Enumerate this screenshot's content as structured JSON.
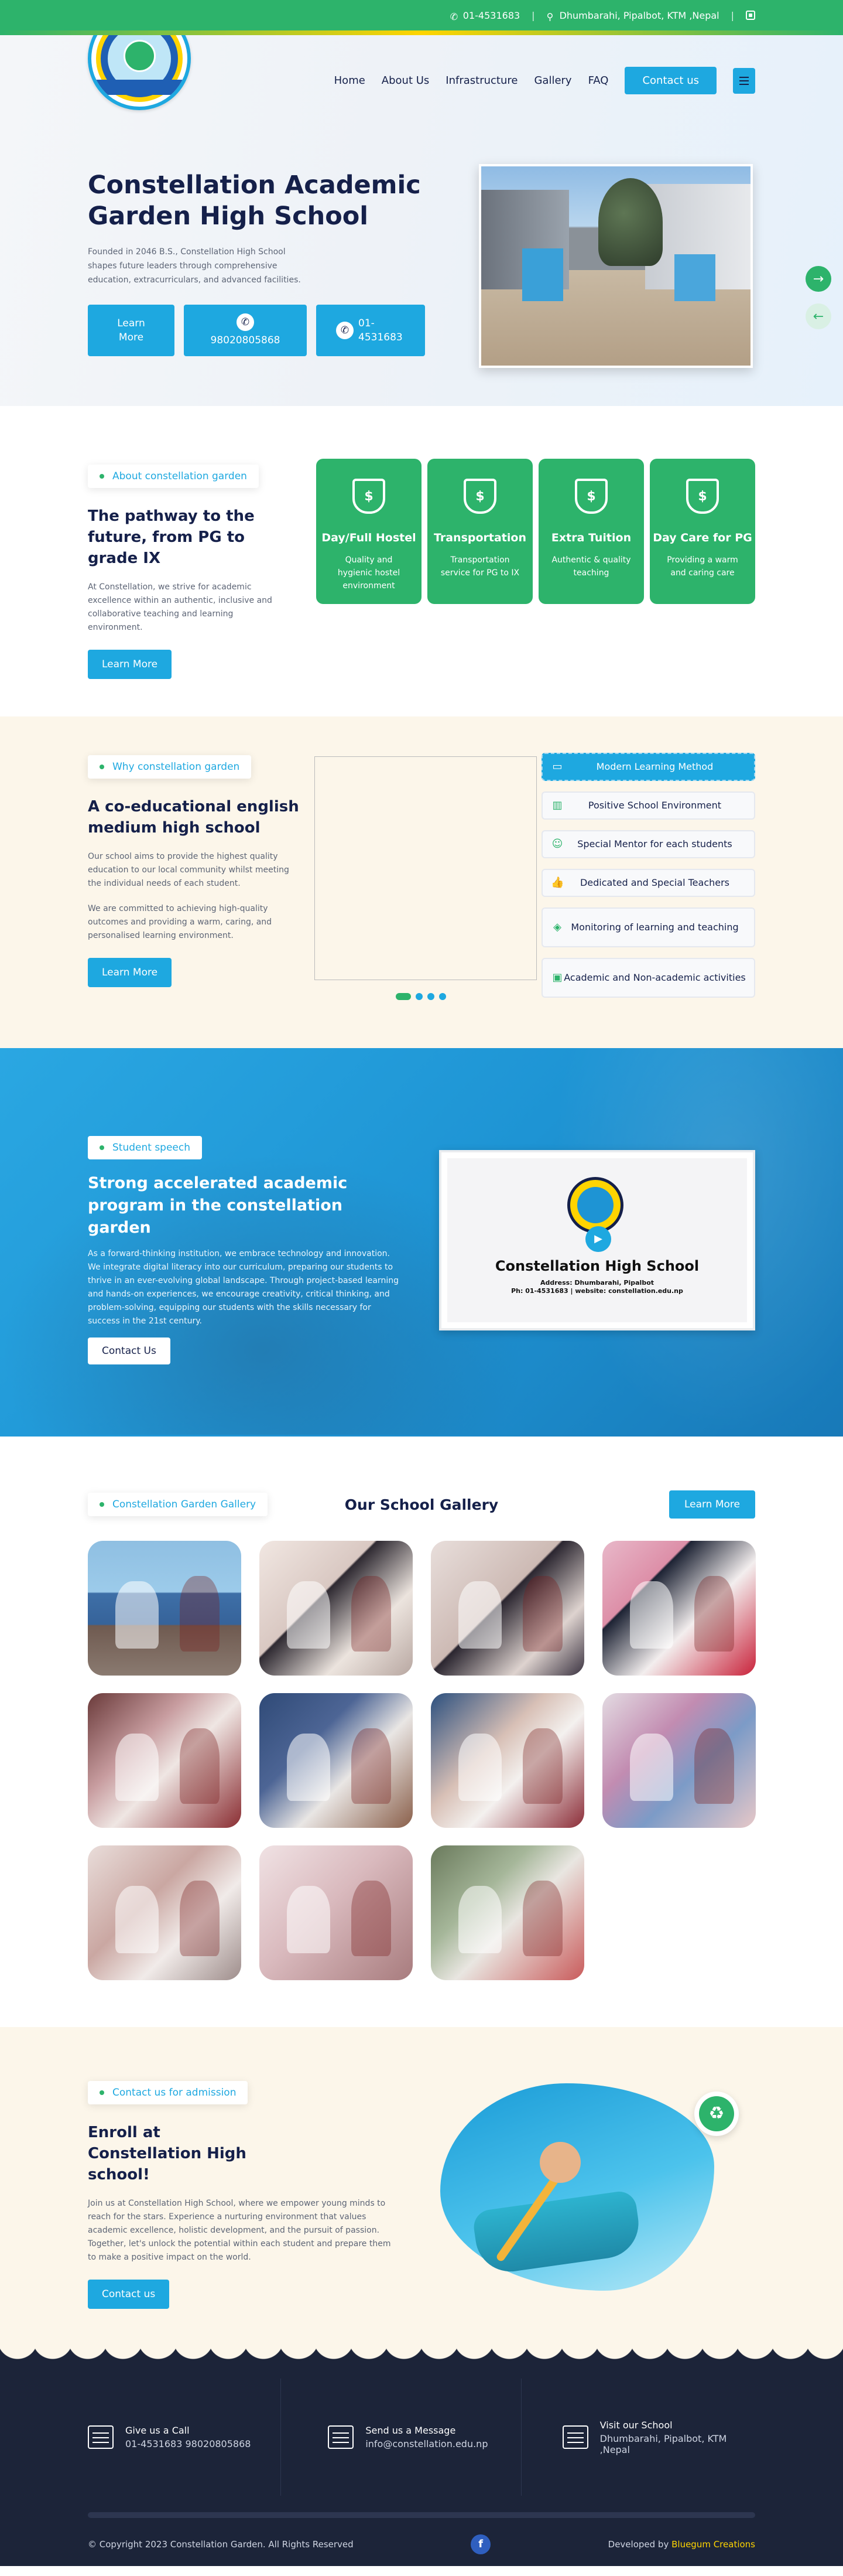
{
  "topbar": {
    "phone": "01-4531683",
    "address": "Dhumbarahi, Pipalbot, KTM ,Nepal"
  },
  "nav": {
    "items": [
      "Home",
      "About Us",
      "Infrastructure",
      "Gallery",
      "FAQ"
    ],
    "contact_label": "Contact us"
  },
  "hero": {
    "title": "Constellation Academic Garden High School",
    "description": "Founded in 2046 B.S., Constellation High School shapes future leaders through comprehensive education, extracurriculars, and advanced facilities.",
    "learn_more": "Learn More",
    "mobile": "9802080586​8",
    "landline": "01-4531683"
  },
  "about": {
    "pill": "About constellation garden",
    "heading": "The pathway to the future, from PG to grade IX",
    "body": "At Constellation, we strive for academic excellence within an authentic, inclusive and collaborative teaching and learning environment.",
    "learn_more": "Learn More",
    "cards": [
      {
        "title": "Day/Full Hostel",
        "desc": "Quality and hygienic hostel environment"
      },
      {
        "title": "Transportation",
        "desc": "Transportation service for PG to IX"
      },
      {
        "title": "Extra Tuition",
        "desc": "Authentic & quality teaching"
      },
      {
        "title": "Day Care for PG",
        "desc": "Providing a warm and caring care"
      }
    ]
  },
  "why": {
    "pill": "Why constellation garden",
    "heading": "A co-educational english medium high school",
    "body1": "Our school aims to provide the highest quality education to our local community whilst meeting the individual needs of each student.",
    "body2": "We are committed to achieving high-quality outcomes and providing a warm, caring, and personalised learning environment.",
    "learn_more": "Learn More",
    "features": [
      "Modern Learning Method",
      "Positive School Environment",
      "Special Mentor for each students",
      "Dedicated and Special Teachers",
      "Monitoring of learning and teaching",
      "Academic and Non-academic activities"
    ]
  },
  "speech": {
    "pill": "Student speech",
    "heading": "Strong accelerated academic program in the constellation garden",
    "body": "As a forward-thinking institution, we embrace technology and innovation. We integrate digital literacy into our curriculum, preparing our students to thrive in an ever-evolving global landscape. Through project-based learning and hands-on experiences, we encourage creativity, critical thinking, and problem-solving, equipping our students with the skills necessary for success in the 21st century.",
    "contact": "Contact Us",
    "video_title": "Constellation High School",
    "video_address": "Address: Dhumbarahi, Pipalbot",
    "video_contact": "Ph: 01-4531683 | website: constellation.edu.np"
  },
  "gallery": {
    "pill": "Constellation Garden Gallery",
    "title": "Our School Gallery",
    "learn_more": "Learn More",
    "photo_count": 11
  },
  "enroll": {
    "pill": "Contact us for admission",
    "heading": "Enroll at Constellation High school!",
    "body": "Join us at Constellation High School, where we empower young minds to reach for the stars. Experience a nurturing environment that values academic excellence, holistic development, and the pursuit of passion. Together, let's unlock the potential within each student and prepare them to make a positive impact on the world.",
    "contact": "Contact us"
  },
  "footer": {
    "call_label": "Give us a Call",
    "call_value": "01-4531683  9802080586​8",
    "msg_label": "Send us a Message",
    "msg_value": "info@constellation.edu.np",
    "visit_label": "Visit our School",
    "visit_value": "Dhumbarahi, Pipalbot, KTM ,Nepal",
    "copyright": "© Copyright 2023 Constellation Garden. All Rights Reserved",
    "developed_by": "Developed by",
    "developer": "Bluegum Creations"
  },
  "colors": {
    "green": "#2db36b",
    "blue": "#1ea8e0",
    "navy": "#15204a",
    "cream": "#fcf6ea",
    "footer": "#1c2439"
  }
}
